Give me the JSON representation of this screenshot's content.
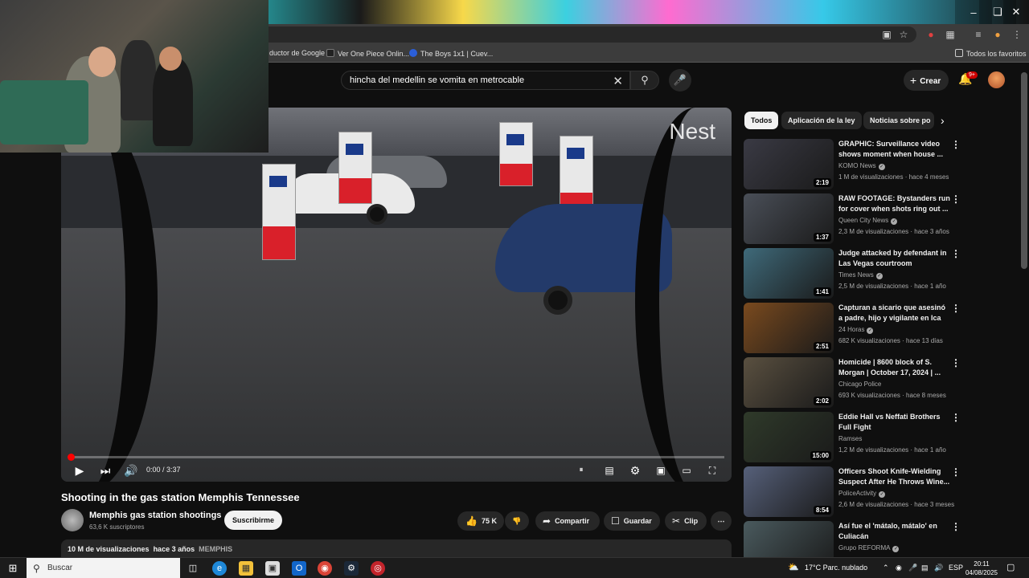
{
  "browser": {
    "bookmarks": [
      {
        "label": "ductor de Google"
      },
      {
        "label": "Ver One Piece Onlin..."
      },
      {
        "label": "The Boys 1x1 | Cuev..."
      }
    ],
    "all_favorites": "Todos los favoritos"
  },
  "header": {
    "search_query": "hincha del medellin se vomita en metrocable",
    "create_label": "Crear",
    "notification_badge": "9+"
  },
  "video": {
    "watermark": "Nest",
    "time": "0:00 / 3:37",
    "progress": 0.0,
    "title": "Shooting in the gas station Memphis Tennessee",
    "channel": "Memphis gas station shootings",
    "subscribers": "63,6 K suscriptores",
    "subscribe_label": "Suscribirme",
    "likes": "75 K",
    "share_label": "Compartir",
    "save_label": "Guardar",
    "clip_label": "Clip",
    "views": "10 M de visualizaciones",
    "age": "hace 3 años",
    "tag": "MEMPHIS"
  },
  "chips": [
    {
      "label": "Todos",
      "active": true
    },
    {
      "label": "Aplicación de la ley",
      "active": false
    },
    {
      "label": "Noticias sobre po",
      "active": false
    }
  ],
  "recommendations": [
    {
      "title": "GRAPHIC: Surveillance video shows moment when house ...",
      "channel": "KOMO News",
      "verified": true,
      "meta": "1 M de visualizaciones · hace 4 meses",
      "duration": "2:19",
      "thumb_color": "#3a3a44"
    },
    {
      "title": "RAW FOOTAGE: Bystanders run for cover when shots ring out ...",
      "channel": "Queen City News",
      "verified": true,
      "meta": "2,3 M de visualizaciones · hace 3 años",
      "duration": "1:37",
      "thumb_color": "#4a4f58"
    },
    {
      "title": "Judge attacked by defendant in Las Vegas courtroom",
      "channel": "Times News",
      "verified": true,
      "meta": "2,5 M de visualizaciones · hace 1 año",
      "duration": "1:41",
      "thumb_color": "#3f6a7a"
    },
    {
      "title": "Capturan a sicario que asesinó a padre, hijo y vigilante en Ica",
      "channel": "24 Horas",
      "verified": true,
      "meta": "682 K visualizaciones · hace 13 días",
      "duration": "2:51",
      "thumb_color": "#7a4a1e"
    },
    {
      "title": "Homicide | 8600 block of S. Morgan | October 17, 2024 | ...",
      "channel": "Chicago Police",
      "verified": false,
      "meta": "693 K visualizaciones · hace 8 meses",
      "duration": "2:02",
      "thumb_color": "#5a5040"
    },
    {
      "title": "Eddie Hall vs Neffati Brothers Full Fight",
      "channel": "Ramses",
      "verified": false,
      "meta": "1,2 M de visualizaciones · hace 1 año",
      "duration": "15:00",
      "thumb_color": "#2f3a2a"
    },
    {
      "title": "Officers Shoot Knife-Wielding Suspect After He Throws Wine...",
      "channel": "PoliceActivity",
      "verified": true,
      "meta": "2,6 M de visualizaciones · hace 3 meses",
      "duration": "8:54",
      "thumb_color": "#56607a"
    },
    {
      "title": "Así fue el 'mátalo, mátalo' en Culiacán",
      "channel": "Grupo REFORMA",
      "verified": true,
      "meta": "",
      "duration": "",
      "thumb_color": "#4a5a5e"
    }
  ],
  "taskbar": {
    "search_placeholder": "Buscar",
    "weather": "17°C  Parc. nublado",
    "language": "ESP",
    "time": "20:11",
    "date": "04/08/2025"
  },
  "colors": {
    "accent_red": "#ff0000",
    "background": "#0f0f0f",
    "chip_bg": "#272727"
  }
}
